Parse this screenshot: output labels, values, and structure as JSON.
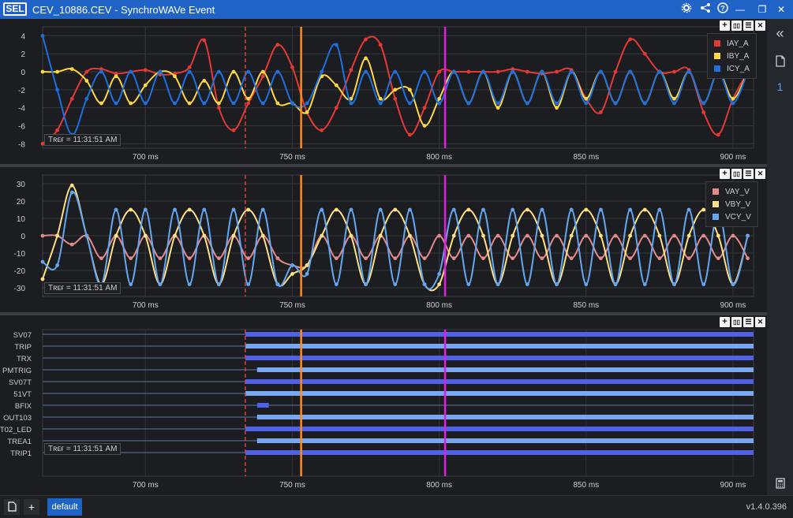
{
  "app": {
    "logo": "SEL",
    "title": "CEV_10886.CEV - SynchroWAVe Event",
    "version": "v1.4.0.396"
  },
  "title_buttons": {
    "settings_icon": "gear-icon",
    "share_icon": "share-icon",
    "help_icon": "help-icon",
    "minimize": "—",
    "restore": "❐",
    "close": "✕"
  },
  "panel_controls": {
    "add": "+",
    "split": "▯▯",
    "stack": "☰",
    "close": "✕"
  },
  "x_ticks": [
    "700 ms",
    "750 ms",
    "800 ms",
    "850 ms",
    "900 ms"
  ],
  "tref_label": "Tʀᴇғ = 11:31:51 AM",
  "colors": {
    "IAY": "#e53935",
    "IBY": "#ffd740",
    "ICY": "#1e6fe0",
    "VAY": "#e58a8a",
    "VBY": "#ffe082",
    "VCY": "#64a5ee",
    "cursor_dashed": "#e53935",
    "cursor_orange": "#ff8c1a",
    "cursor_magenta": "#e020e0",
    "digital_on": "#4f61e8",
    "digital_on_light": "#7aa8f0",
    "digital_off": "#4a5a7a"
  },
  "current_panel": {
    "y_ticks": [
      "4",
      "2",
      "0",
      "-2",
      "-4",
      "-6",
      "-8"
    ],
    "legend": [
      "IAY_A",
      "IBY_A",
      "ICY_A"
    ]
  },
  "voltage_panel": {
    "y_ticks": [
      "30",
      "20",
      "10",
      "0",
      "-10",
      "-20",
      "-30"
    ],
    "legend": [
      "VAY_V",
      "VBY_V",
      "VCY_V"
    ]
  },
  "digital_panel": {
    "channels": [
      "SV07",
      "TRIP",
      "TRX",
      "PMTRIG",
      "SV07T",
      "51VT",
      "BFIX",
      "OUT103",
      "T02_LED",
      "TREA1",
      "TRIP1"
    ]
  },
  "status": {
    "default_tab": "default",
    "page_icon": "page-icon",
    "add_label": "+"
  },
  "right_sidebar": {
    "collapse": "«",
    "doc_icon": "document-icon",
    "count": "1",
    "calc_icon": "calculator-icon"
  },
  "chart_data": [
    {
      "type": "line",
      "title": "",
      "x_unit": "ms",
      "xlim": [
        665,
        907
      ],
      "ylim": [
        -8.5,
        5
      ],
      "grid": true,
      "legend_position": "top-right",
      "series": [
        {
          "name": "IAY_A",
          "x": [
            665,
            670,
            675,
            680,
            685,
            690,
            695,
            700,
            705,
            710,
            715,
            720,
            725,
            730,
            735,
            740,
            745,
            750,
            755,
            760,
            765,
            770,
            775,
            780,
            785,
            790,
            795,
            800,
            805,
            810,
            815,
            820,
            825,
            830,
            835,
            840,
            845,
            850,
            855,
            860,
            865,
            870,
            875,
            880,
            885,
            890,
            895,
            900,
            905
          ],
          "y": [
            -8.0,
            -6.5,
            -3.0,
            0.0,
            0.3,
            -0.2,
            0.0,
            0.2,
            -0.3,
            -0.2,
            0.5,
            3.5,
            -4.0,
            -6.5,
            -3.5,
            -0.5,
            3.0,
            0.5,
            -4.5,
            -6.5,
            -4.0,
            0.2,
            3.6,
            3.0,
            -3.0,
            -7.0,
            -4.0,
            0.0,
            0.0,
            0.0,
            0.0,
            0.0,
            0.3,
            0.0,
            -0.2,
            0.0,
            0.2,
            -3.0,
            -4.5,
            0.0,
            3.6,
            2.0,
            0.0,
            0.0,
            0.2,
            -4.5,
            -7.0,
            -3.0,
            0.0
          ]
        },
        {
          "name": "IBY_A",
          "x": [
            665,
            670,
            675,
            680,
            685,
            690,
            695,
            700,
            705,
            710,
            715,
            720,
            725,
            730,
            735,
            740,
            745,
            750,
            755,
            760,
            765,
            770,
            775,
            780,
            785,
            790,
            795,
            800,
            805,
            810,
            815,
            820,
            825,
            830,
            835,
            840,
            845,
            850,
            855,
            860,
            865,
            870,
            875,
            880,
            885,
            890,
            895,
            900,
            905
          ],
          "y": [
            0.0,
            0.0,
            0.3,
            -1.0,
            -3.5,
            -0.5,
            -3.5,
            -1.5,
            0.0,
            -0.5,
            -3.5,
            -1.0,
            -3.5,
            0.0,
            -3.0,
            0.0,
            -3.5,
            -3.5,
            -4.5,
            -0.5,
            -1.5,
            -3.0,
            1.5,
            -3.0,
            -2.0,
            -2.0,
            -6.0,
            -3.0,
            0.0,
            -3.5,
            0.0,
            -4.0,
            0.0,
            -3.5,
            0.0,
            -4.0,
            0.0,
            -3.0,
            0.0,
            -3.5,
            0.0,
            -3.5,
            0.0,
            -3.0,
            0.0,
            -3.5,
            0.0,
            -3.0,
            0.0
          ]
        },
        {
          "name": "ICY_A",
          "x": [
            665,
            670,
            675,
            680,
            685,
            690,
            695,
            700,
            705,
            710,
            715,
            720,
            725,
            730,
            735,
            740,
            745,
            750,
            755,
            760,
            765,
            770,
            775,
            780,
            785,
            790,
            795,
            800,
            805,
            810,
            815,
            820,
            825,
            830,
            835,
            840,
            845,
            850,
            855,
            860,
            865,
            870,
            875,
            880,
            885,
            890,
            895,
            900,
            905
          ],
          "y": [
            4.0,
            -2.0,
            -7.0,
            -3.0,
            0.0,
            -3.5,
            0.0,
            -3.5,
            0.0,
            -3.5,
            0.0,
            -3.5,
            0.0,
            -3.5,
            0.0,
            -3.5,
            0.0,
            -3.5,
            -3.5,
            0.0,
            3.0,
            -3.5,
            0.0,
            -3.5,
            0.0,
            -3.5,
            0.0,
            -3.5,
            0.0,
            -3.5,
            0.0,
            -3.5,
            0.0,
            -3.5,
            0.0,
            -3.5,
            0.0,
            -3.5,
            0.0,
            -3.5,
            0.0,
            -3.5,
            0.0,
            -3.5,
            0.0,
            -3.5,
            0.0,
            -3.5,
            0.0
          ]
        }
      ]
    },
    {
      "type": "line",
      "title": "",
      "x_unit": "ms",
      "xlim": [
        665,
        907
      ],
      "ylim": [
        -35,
        35
      ],
      "grid": true,
      "legend_position": "top-right",
      "series": [
        {
          "name": "VAY_V",
          "x": [
            665,
            670,
            675,
            680,
            685,
            690,
            695,
            700,
            705,
            710,
            715,
            720,
            725,
            730,
            735,
            740,
            745,
            750,
            755,
            760,
            765,
            770,
            775,
            780,
            785,
            790,
            795,
            800,
            805,
            810,
            815,
            820,
            825,
            830,
            835,
            840,
            845,
            850,
            855,
            860,
            865,
            870,
            875,
            880,
            885,
            890,
            895,
            900,
            905
          ],
          "y": [
            0,
            0,
            -5,
            0,
            -13,
            0,
            -13,
            0,
            -13,
            0,
            -13,
            0,
            -13,
            0,
            -13,
            0,
            -13,
            -17,
            -17,
            0,
            -13,
            0,
            -13,
            0,
            -13,
            0,
            -13,
            0,
            -13,
            0,
            -13,
            0,
            -13,
            0,
            -13,
            0,
            -13,
            0,
            -13,
            0,
            -13,
            0,
            -13,
            0,
            -13,
            0,
            -13,
            0,
            -13
          ]
        },
        {
          "name": "VBY_V",
          "x": [
            665,
            670,
            675,
            680,
            685,
            690,
            695,
            700,
            705,
            710,
            715,
            720,
            725,
            730,
            735,
            740,
            745,
            750,
            755,
            760,
            765,
            770,
            775,
            780,
            785,
            790,
            795,
            800,
            805,
            810,
            815,
            820,
            825,
            830,
            835,
            840,
            845,
            850,
            855,
            860,
            865,
            870,
            875,
            880,
            885,
            890,
            895,
            900,
            905
          ],
          "y": [
            -25,
            0,
            29,
            0,
            -28,
            0,
            15,
            0,
            -28,
            0,
            15,
            0,
            -28,
            0,
            15,
            0,
            -28,
            -22,
            -17,
            0,
            15,
            0,
            -28,
            0,
            15,
            0,
            -28,
            -28,
            0,
            15,
            0,
            -28,
            0,
            15,
            0,
            -28,
            0,
            15,
            0,
            -28,
            0,
            15,
            0,
            -28,
            0,
            15,
            0,
            -28,
            0
          ]
        },
        {
          "name": "VCY_V",
          "x": [
            665,
            670,
            675,
            680,
            685,
            690,
            695,
            700,
            705,
            710,
            715,
            720,
            725,
            730,
            735,
            740,
            745,
            750,
            755,
            760,
            765,
            770,
            775,
            780,
            785,
            790,
            795,
            800,
            805,
            810,
            815,
            820,
            825,
            830,
            835,
            840,
            845,
            850,
            855,
            860,
            865,
            870,
            875,
            880,
            885,
            890,
            895,
            900,
            905
          ],
          "y": [
            -15,
            -17,
            25,
            0,
            -28,
            15,
            -28,
            15,
            -28,
            15,
            -28,
            15,
            -28,
            15,
            -28,
            15,
            -28,
            -17,
            -22,
            15,
            -28,
            15,
            -28,
            15,
            -28,
            15,
            -28,
            -22,
            15,
            -28,
            15,
            -28,
            15,
            -28,
            15,
            -28,
            15,
            -28,
            15,
            -28,
            15,
            -28,
            15,
            -28,
            15,
            -28,
            15,
            -28,
            0
          ]
        }
      ]
    }
  ]
}
